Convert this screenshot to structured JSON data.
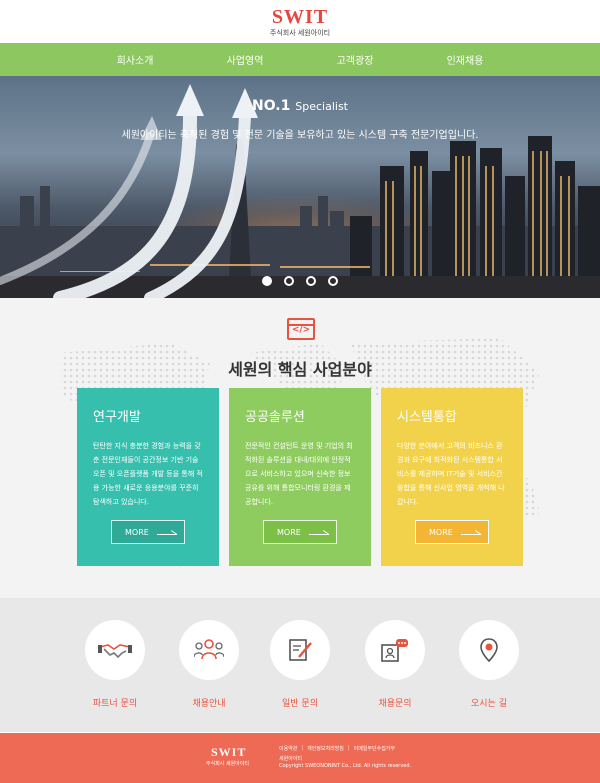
{
  "header": {
    "logo": "SWIT",
    "logo_sub": "주식회사 세원아이티"
  },
  "nav": [
    "회사소개",
    "사업영역",
    "고객광장",
    "인재채용"
  ],
  "hero": {
    "title_strong": "NO.1",
    "title_rest": "Specialist",
    "description": "세원아이티는 축적된 경험 및 전문 기술을 보유하고 있는 시스템 구축 전문기업입니다.",
    "active_slide": 1,
    "slide_count": 4
  },
  "core": {
    "icon_text": "</>",
    "title": "세원의 핵심 사업분야",
    "cards": [
      {
        "title": "연구개발",
        "text": "탄탄한 지식 충분한 경험과 능력을 갖춘 전문인재들이 공간정보 기반 기술 오픈 및 오픈플랫폼 개발 등을 통해 적용 가능한 새로운 응용분야를 꾸준히 탐색하고 있습니다.",
        "more": "MORE",
        "color": "#37bfad"
      },
      {
        "title": "공공솔루션",
        "text": "전문적인 컨설턴트 운영 및 기업의 최적화된 솔루션을 대내/대외에 안정적으로 서비스하고 있으며 신속한 정보공유를 위해 통합모니터링 환경을 제공합니다.",
        "more": "MORE",
        "color": "#8fcc5f"
      },
      {
        "title": "시스템통합",
        "text": "다양한 분야에서 고객의 비즈니스 환경과 요구에 최적화된 시스템통합 서비스를 제공하며 IT기술 및 서비스간 융합을 통해 신사업 영역을 개척해 나갑니다.",
        "more": "MORE",
        "color": "#f3d24b"
      }
    ]
  },
  "contact": [
    {
      "label": "파트너 문의",
      "icon": "handshake-icon"
    },
    {
      "label": "채용안내",
      "icon": "people-icon"
    },
    {
      "label": "일반 문의",
      "icon": "document-pen-icon"
    },
    {
      "label": "채용문의",
      "icon": "id-chat-icon"
    },
    {
      "label": "오시는 길",
      "icon": "map-pin-icon"
    }
  ],
  "footer": {
    "logo": "SWIT",
    "logo_sub": "주식회사 세원아이티",
    "links": [
      "이용약관",
      "개인정보처리방침",
      "이메일무단수집거부"
    ],
    "company": "세원아이티",
    "copyright": "Copyright SWEONONINT Co., Ltd. All rights reserved."
  },
  "colors": {
    "accent": "#e8533f",
    "nav": "#8cc760",
    "footer": "#ef6a54"
  }
}
